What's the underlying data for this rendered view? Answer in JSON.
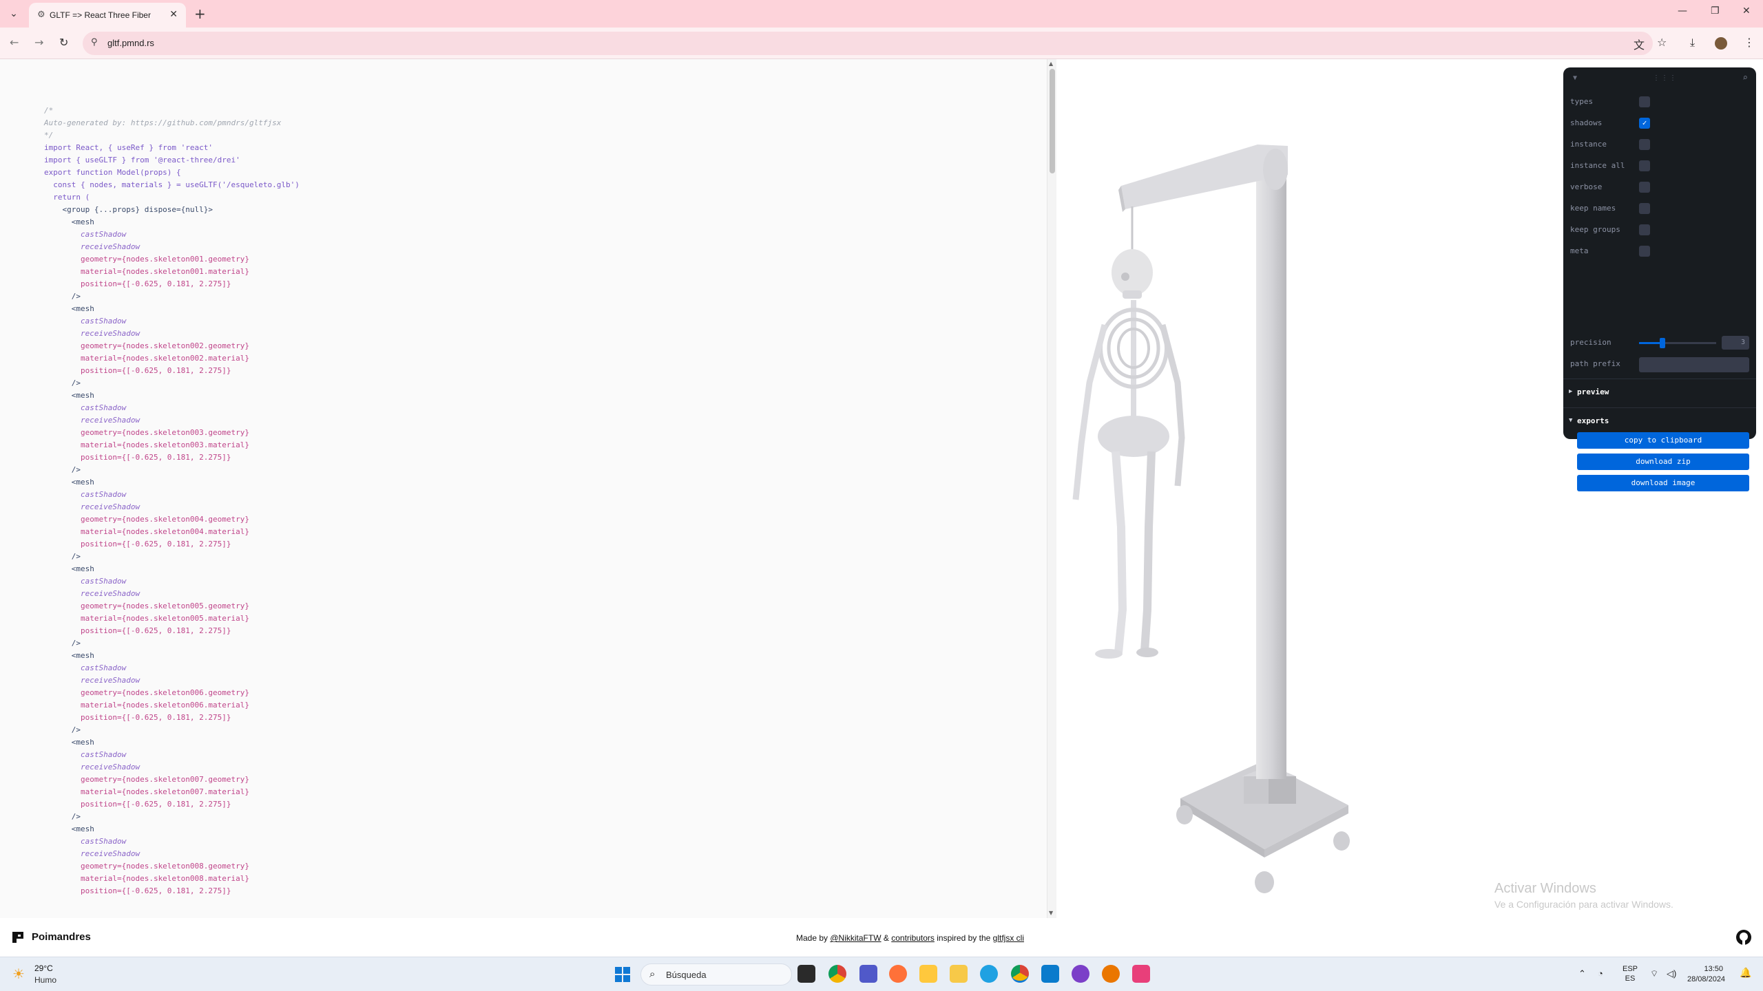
{
  "browser": {
    "tab_title": "GLTF => React Three Fiber",
    "url": "gltf.pmnd.rs"
  },
  "code": {
    "lines": [
      "/*",
      "Auto-generated by: https://github.com/pmndrs/gltfjsx",
      "*/",
      "",
      "import React, { useRef } from 'react'",
      "import { useGLTF } from '@react-three/drei'",
      "",
      "export function Model(props) {",
      "  const { nodes, materials } = useGLTF('/esqueleto.glb')",
      "  return (",
      "    <group {...props} dispose={null}>",
      "      <mesh",
      "        castShadow",
      "        receiveShadow",
      "        geometry={nodes.skeleton001.geometry}",
      "        material={nodes.skeleton001.material}",
      "        position={[-0.625, 0.181, 2.275]}",
      "      />",
      "      <mesh",
      "        castShadow",
      "        receiveShadow",
      "        geometry={nodes.skeleton002.geometry}",
      "        material={nodes.skeleton002.material}",
      "        position={[-0.625, 0.181, 2.275]}",
      "      />",
      "      <mesh",
      "        castShadow",
      "        receiveShadow",
      "        geometry={nodes.skeleton003.geometry}",
      "        material={nodes.skeleton003.material}",
      "        position={[-0.625, 0.181, 2.275]}",
      "      />",
      "      <mesh",
      "        castShadow",
      "        receiveShadow",
      "        geometry={nodes.skeleton004.geometry}",
      "        material={nodes.skeleton004.material}",
      "        position={[-0.625, 0.181, 2.275]}",
      "      />",
      "      <mesh",
      "        castShadow",
      "        receiveShadow",
      "        geometry={nodes.skeleton005.geometry}",
      "        material={nodes.skeleton005.material}",
      "        position={[-0.625, 0.181, 2.275]}",
      "      />",
      "      <mesh",
      "        castShadow",
      "        receiveShadow",
      "        geometry={nodes.skeleton006.geometry}",
      "        material={nodes.skeleton006.material}",
      "        position={[-0.625, 0.181, 2.275]}",
      "      />",
      "      <mesh",
      "        castShadow",
      "        receiveShadow",
      "        geometry={nodes.skeleton007.geometry}",
      "        material={nodes.skeleton007.material}",
      "        position={[-0.625, 0.181, 2.275]}",
      "      />",
      "      <mesh",
      "        castShadow",
      "        receiveShadow",
      "        geometry={nodes.skeleton008.geometry}",
      "        material={nodes.skeleton008.material}",
      "        position={[-0.625, 0.181, 2.275]}"
    ]
  },
  "panel": {
    "options": [
      {
        "label": "types",
        "checked": false
      },
      {
        "label": "shadows",
        "checked": true
      },
      {
        "label": "instance",
        "checked": false
      },
      {
        "label": "instance all",
        "checked": false
      },
      {
        "label": "verbose",
        "checked": false
      },
      {
        "label": "keep names",
        "checked": false
      },
      {
        "label": "keep groups",
        "checked": false
      },
      {
        "label": "meta",
        "checked": false
      }
    ],
    "precision_label": "precision",
    "precision_value": "3",
    "precision_fraction": 0.3,
    "path_prefix_label": "path prefix",
    "path_prefix_value": "",
    "preview_label": "preview",
    "exports_label": "exports",
    "buttons": {
      "copy": "copy to clipboard",
      "zip": "download zip",
      "image": "download image"
    },
    "accent_color": "#0066dc"
  },
  "watermark": {
    "title": "Activar Windows",
    "subtitle": "Ve a Configuración para activar Windows."
  },
  "footer": {
    "brand": "Poimandres",
    "made_by": "Made by ",
    "author": "@NikkitaFTW",
    "amp": " & ",
    "contributors": "contributors",
    "inspired": " inspired by the ",
    "cli": "gltfjsx cli"
  },
  "taskbar": {
    "temp": "29°C",
    "condition": "Humo",
    "search_placeholder": "Búsqueda",
    "lang_top": "ESP",
    "lang_bottom": "ES",
    "time": "13:50",
    "date": "28/08/2024"
  }
}
